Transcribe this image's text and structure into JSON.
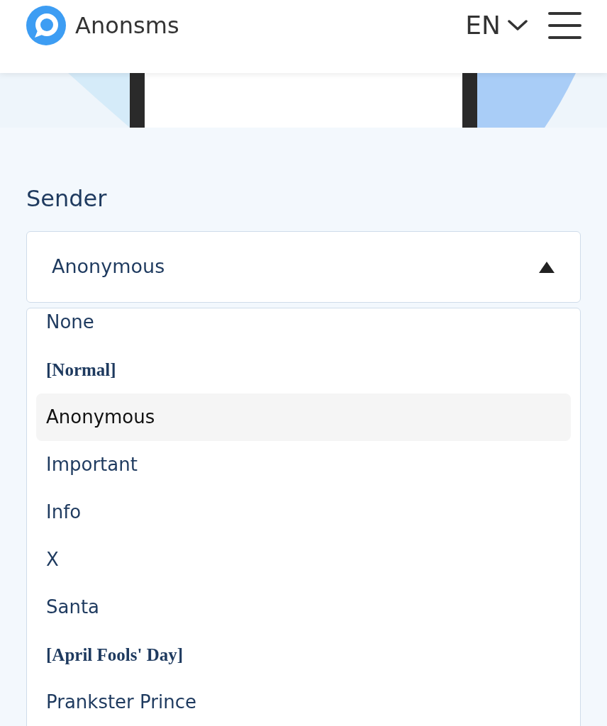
{
  "header": {
    "brand": "Anonsms",
    "language": "EN"
  },
  "form": {
    "label": "Sender",
    "select": {
      "value": "Anonymous",
      "expanded": true
    }
  },
  "dropdown": {
    "items": [
      {
        "kind": "option",
        "label": "None",
        "selected": false
      },
      {
        "kind": "group",
        "label": "[Normal]",
        "selected": false
      },
      {
        "kind": "option",
        "label": "Anonymous",
        "selected": true
      },
      {
        "kind": "option",
        "label": "Important",
        "selected": false
      },
      {
        "kind": "option",
        "label": "Info",
        "selected": false
      },
      {
        "kind": "option",
        "label": "X",
        "selected": false
      },
      {
        "kind": "option",
        "label": "Santa",
        "selected": false
      },
      {
        "kind": "group",
        "label": "[April Fools' Day]",
        "selected": false
      },
      {
        "kind": "option",
        "label": "Prankster Prince",
        "selected": false
      }
    ]
  }
}
